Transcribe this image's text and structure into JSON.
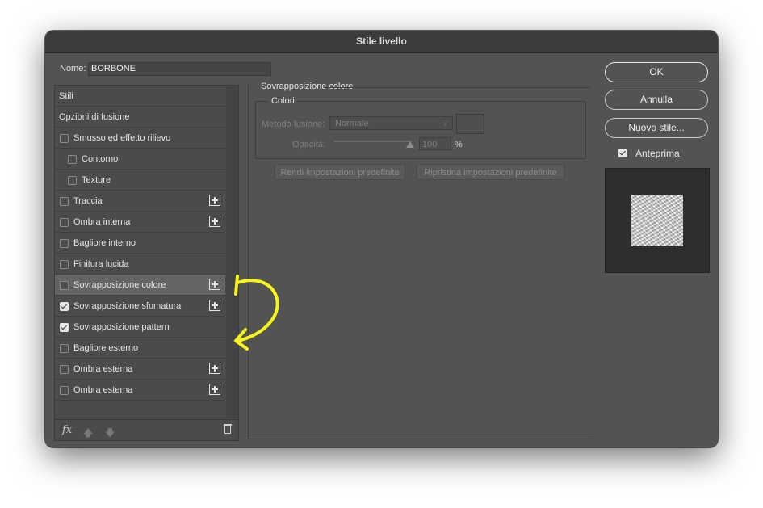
{
  "dialog": {
    "title": "Stile livello"
  },
  "name": {
    "label": "Nome:",
    "value": "BORBONE"
  },
  "list": {
    "items": [
      {
        "label": "Stili",
        "checkbox": false,
        "checked": false,
        "indent": 0,
        "plus": false,
        "selected": false
      },
      {
        "label": "Opzioni di fusione",
        "checkbox": false,
        "checked": false,
        "indent": 0,
        "plus": false,
        "selected": false
      },
      {
        "label": "Smusso ed effetto rilievo",
        "checkbox": true,
        "checked": false,
        "indent": 0,
        "plus": false,
        "selected": false
      },
      {
        "label": "Contorno",
        "checkbox": true,
        "checked": false,
        "indent": 1,
        "plus": false,
        "selected": false
      },
      {
        "label": "Texture",
        "checkbox": true,
        "checked": false,
        "indent": 1,
        "plus": false,
        "selected": false
      },
      {
        "label": "Traccia",
        "checkbox": true,
        "checked": false,
        "indent": 0,
        "plus": true,
        "selected": false
      },
      {
        "label": "Ombra interna",
        "checkbox": true,
        "checked": false,
        "indent": 0,
        "plus": true,
        "selected": false
      },
      {
        "label": "Bagliore interno",
        "checkbox": true,
        "checked": false,
        "indent": 0,
        "plus": false,
        "selected": false
      },
      {
        "label": "Finitura lucida",
        "checkbox": true,
        "checked": false,
        "indent": 0,
        "plus": false,
        "selected": false
      },
      {
        "label": "Sovrapposizione colore",
        "checkbox": true,
        "checked": false,
        "indent": 0,
        "plus": true,
        "selected": true
      },
      {
        "label": "Sovrapposizione sfumatura",
        "checkbox": true,
        "checked": true,
        "indent": 0,
        "plus": true,
        "selected": false
      },
      {
        "label": "Sovrapposizione pattern",
        "checkbox": true,
        "checked": true,
        "indent": 0,
        "plus": false,
        "selected": false
      },
      {
        "label": "Bagliore esterno",
        "checkbox": true,
        "checked": false,
        "indent": 0,
        "plus": false,
        "selected": false
      },
      {
        "label": "Ombra esterna",
        "checkbox": true,
        "checked": false,
        "indent": 0,
        "plus": true,
        "selected": false
      },
      {
        "label": "Ombra esterna",
        "checkbox": true,
        "checked": false,
        "indent": 0,
        "plus": true,
        "selected": false
      }
    ],
    "footer": {
      "fx_label": "fx",
      "up_icon": "arrow-up-icon",
      "down_icon": "arrow-down-icon",
      "trash_icon": "trash-icon"
    }
  },
  "settings": {
    "section_title": "Sovrapposizione colore",
    "group_title": "Colori",
    "blend_label": "Metodo fusione:",
    "blend_value": "Normale",
    "opacity_label": "Opacità:",
    "opacity_value": "100",
    "opacity_unit": "%",
    "opacity_level": 1.0,
    "btn_default": "Rendi impostazioni predefinite",
    "btn_reset": "Ripristina impostazioni predefinite"
  },
  "actions": {
    "ok": "OK",
    "cancel": "Annulla",
    "new_style": "Nuovo stile...",
    "preview_label": "Anteprima",
    "preview_checked": true
  },
  "colors": {
    "window_bg": "#535353",
    "titlebar_bg": "#3c3c3c",
    "selected_row": "#646464",
    "annotation": "#f7f41a"
  }
}
